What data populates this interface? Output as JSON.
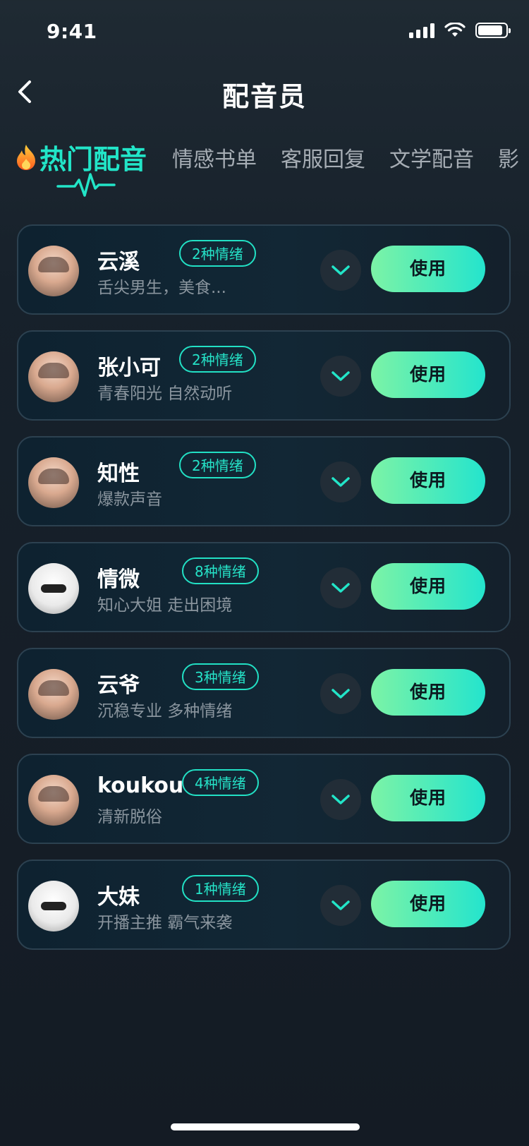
{
  "status": {
    "time": "9:41",
    "battery_level": 0.9
  },
  "nav": {
    "title": "配音员"
  },
  "tabs": [
    {
      "label": "热门配音",
      "active": true,
      "icon": "fire-icon"
    },
    {
      "label": "情感书单",
      "active": false
    },
    {
      "label": "客服回复",
      "active": false
    },
    {
      "label": "文学配音",
      "active": false
    },
    {
      "label": "影",
      "active": false
    }
  ],
  "voices": [
    {
      "name": "云溪",
      "badge": "2种情绪",
      "desc": "舌尖男生，美食...",
      "button": "使用"
    },
    {
      "name": "张小可",
      "badge": "2种情绪",
      "desc": "青春阳光 自然动听",
      "button": "使用"
    },
    {
      "name": "知性",
      "badge": "2种情绪",
      "desc": "爆款声音",
      "button": "使用"
    },
    {
      "name": "情微",
      "badge": "8种情绪",
      "desc": "知心大姐 走出困境",
      "button": "使用"
    },
    {
      "name": "云爷",
      "badge": "3种情绪",
      "desc": "沉稳专业  多种情绪",
      "button": "使用"
    },
    {
      "name": "koukou",
      "badge": "4种情绪",
      "desc": "清新脱俗",
      "button": "使用"
    },
    {
      "name": "大妹",
      "badge": "1种情绪",
      "desc": "开播主推 霸气来袭",
      "button": "使用"
    }
  ],
  "colors": {
    "accent": "#22e5c8",
    "button_start": "#7cf3a6",
    "button_end": "#24e4cd",
    "background": "#141b24"
  }
}
